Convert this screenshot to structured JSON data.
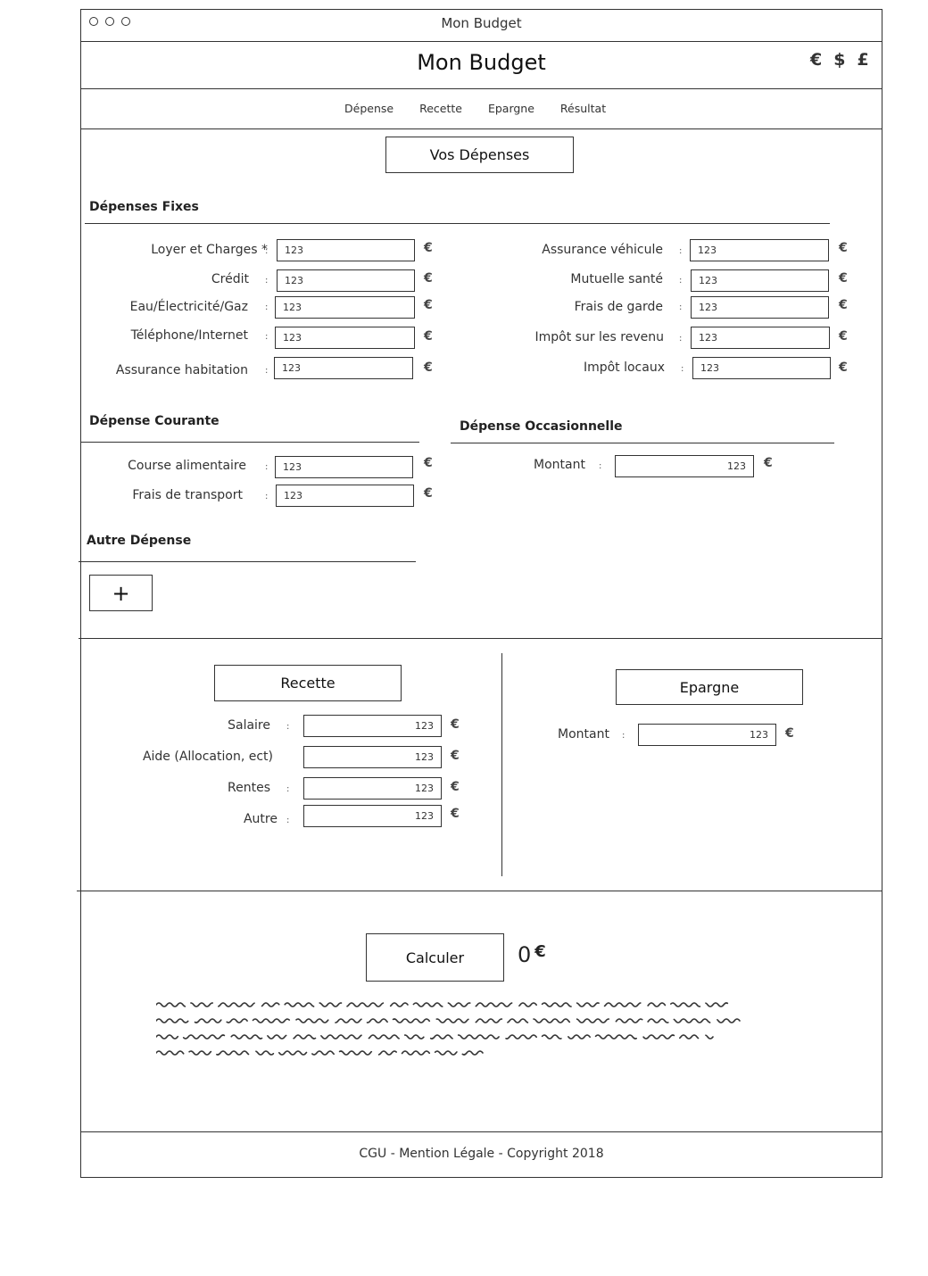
{
  "window": {
    "title": "Mon Budget"
  },
  "header": {
    "title": "Mon Budget",
    "currencies": [
      "€",
      "$",
      "£"
    ]
  },
  "nav": {
    "items": [
      "Dépense",
      "Recette",
      "Epargne",
      "Résultat"
    ]
  },
  "depenses": {
    "button_label": "Vos Dépenses",
    "fixes": {
      "title": "Dépenses Fixes",
      "left": [
        {
          "label": "Loyer et Charges *",
          "value": "123"
        },
        {
          "label": "Crédit",
          "value": "123"
        },
        {
          "label": "Eau/Électricité/Gaz",
          "value": "123"
        },
        {
          "label": "Téléphone/Internet",
          "value": "123"
        },
        {
          "label": "Assurance habitation",
          "value": "123"
        }
      ],
      "right": [
        {
          "label": "Assurance véhicule",
          "value": "123"
        },
        {
          "label": "Mutuelle santé",
          "value": "123"
        },
        {
          "label": "Frais de garde",
          "value": "123"
        },
        {
          "label": "Impôt sur les revenu",
          "value": "123"
        },
        {
          "label": "Impôt locaux",
          "value": "123"
        }
      ]
    },
    "courante": {
      "title": "Dépense Courante",
      "items": [
        {
          "label": "Course alimentaire",
          "value": "123"
        },
        {
          "label": "Frais de transport",
          "value": "123"
        }
      ]
    },
    "occasionnelle": {
      "title": "Dépense Occasionnelle",
      "label": "Montant",
      "value": "123"
    },
    "autre": {
      "title": "Autre Dépense",
      "add_label": "+"
    }
  },
  "recette": {
    "button_label": "Recette",
    "items": [
      {
        "label": "Salaire",
        "value": "123"
      },
      {
        "label": "Aide (Allocation, ect)",
        "value": "123"
      },
      {
        "label": "Rentes",
        "value": "123"
      },
      {
        "label": "Autre",
        "value": "123"
      }
    ]
  },
  "epargne": {
    "button_label": "Epargne",
    "label": "Montant",
    "value": "123"
  },
  "resultat": {
    "button_label": "Calculer",
    "value": "0",
    "currency": "€"
  },
  "symbols": {
    "colon": ":",
    "euro": "€"
  },
  "footer": {
    "text": "CGU - Mention Légale - Copyright 2018"
  },
  "colors": {
    "stroke": "#333333",
    "background": "#ffffff"
  }
}
